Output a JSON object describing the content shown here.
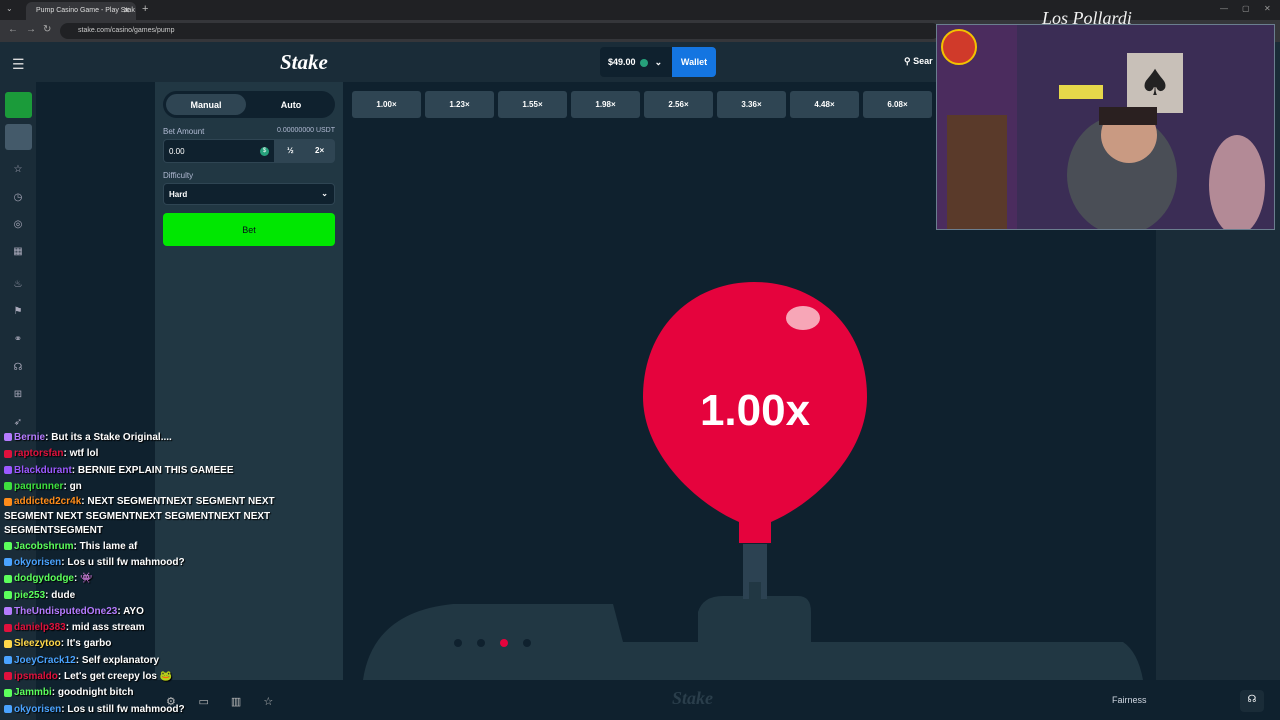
{
  "browser": {
    "tab_title": "Pump Casino Game - Play Stak",
    "url": "stake.com/casino/games/pump"
  },
  "header": {
    "logo": "Stake",
    "balance": "$49.00",
    "wallet_label": "Wallet",
    "search_label": "Sear"
  },
  "bet_panel": {
    "tab_manual": "Manual",
    "tab_auto": "Auto",
    "bet_amount_label": "Bet Amount",
    "bet_amount_usdt": "0.00000000 USDT",
    "bet_value": "0.00",
    "coin_symbol": "$",
    "half_label": "½",
    "double_label": "2×",
    "difficulty_label": "Difficulty",
    "difficulty_value": "Hard",
    "bet_button": "Bet"
  },
  "multipliers": [
    "1.00×",
    "1.23×",
    "1.55×",
    "1.98×",
    "2.56×",
    "3.36×",
    "4.48×",
    "6.08×"
  ],
  "game": {
    "balloon_multiplier": "1.00x",
    "balloon_color": "#e5033d",
    "step_dots_active": 3
  },
  "footer": {
    "fairness": "Fairness",
    "watermark": "Stake"
  },
  "webcam": {
    "signature": "Los Pollardi"
  },
  "chat": [
    {
      "user": "Bernie",
      "color": "#b57bff",
      "text": "But its a Stake Original...."
    },
    {
      "user": "raptorsfan",
      "color": "#e0113d",
      "text": "wtf lol"
    },
    {
      "user": "Blackdurant",
      "color": "#9b59ff",
      "text": "BERNIE EXPLAIN THIS GAMEEE"
    },
    {
      "user": "paqrunner",
      "color": "#3ee03e",
      "text": "gn"
    },
    {
      "user": "addicted2cr4k",
      "color": "#ff8c1a",
      "text": "NEXT SEGMENTNEXT SEGMENT NEXT SEGMENT NEXT SEGMENTNEXT SEGMENTNEXT NEXT SEGMENTSEGMENT"
    },
    {
      "user": "Jacobshrum",
      "color": "#5cff5c",
      "text": "This lame af"
    },
    {
      "user": "okyorisen",
      "color": "#4aa3ff",
      "text": "Los u still fw mahmood?"
    },
    {
      "user": "dodgydodge",
      "color": "#5cff5c",
      "text": "👾"
    },
    {
      "user": "pie253",
      "color": "#5cff5c",
      "text": "dude"
    },
    {
      "user": "TheUndisputedOne23",
      "color": "#b57bff",
      "text": "AYO"
    },
    {
      "user": "danielp383",
      "color": "#e0113d",
      "text": "mid ass stream"
    },
    {
      "user": "Sleezytoo",
      "color": "#ffd84a",
      "text": "It's garbo"
    },
    {
      "user": "JoeyCrack12",
      "color": "#4aa3ff",
      "text": "Self explanatory"
    },
    {
      "user": "ipsmaldo",
      "color": "#e0113d",
      "text": "Let's get creepy los 🐸"
    },
    {
      "user": "Jammbi",
      "color": "#5cff5c",
      "text": "goodnight bitch"
    },
    {
      "user": "okyorisen",
      "color": "#4aa3ff",
      "text": "Los u still fw mahmood?"
    }
  ]
}
